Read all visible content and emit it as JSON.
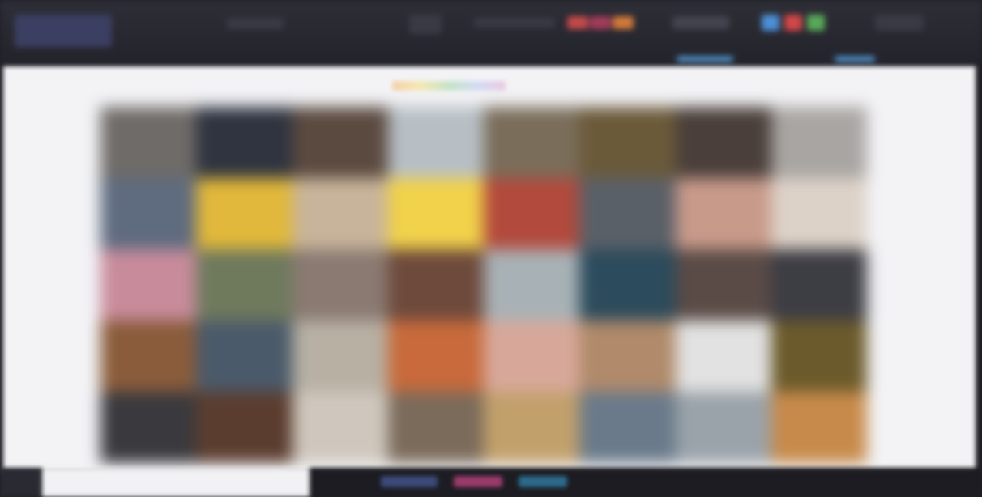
{
  "window": {
    "title": ""
  },
  "topbar": {
    "blocks": [
      {
        "name": "logo",
        "color": "#3b3f62"
      },
      {
        "name": "nav-1",
        "color": "#3a3a44"
      },
      {
        "name": "nav-2",
        "color": "#3a3a44"
      },
      {
        "name": "nav-3",
        "color": "#3a3a44"
      },
      {
        "name": "accent-1",
        "color": "#c54a4a"
      },
      {
        "name": "accent-2",
        "color": "#a43c5a"
      },
      {
        "name": "accent-3",
        "color": "#d27a3a"
      },
      {
        "name": "accent-4",
        "color": "#4d8fd6"
      },
      {
        "name": "accent-5",
        "color": "#d24747"
      },
      {
        "name": "accent-6",
        "color": "#59a85a"
      },
      {
        "name": "highlight-1",
        "color": "#5aa7e8"
      },
      {
        "name": "highlight-2",
        "color": "#5aa7e8"
      }
    ]
  },
  "gallery": {
    "tile_colors": [
      "#6f6b68",
      "#2f3440",
      "#5b4a40",
      "#b7bfc5",
      "#7a6d5a",
      "#6b5a3a",
      "#4a3f3b",
      "#a9a5a2",
      "#5f6b7f",
      "#e1b83b",
      "#c8b49a",
      "#f1d24a",
      "#b24a3d",
      "#5a6068",
      "#c89a8a",
      "#ddd2c8",
      "#c88b9b",
      "#6f7a5d",
      "#8a7a72",
      "#6e4a3c",
      "#a8b2b6",
      "#2c4b5c",
      "#5a4b46",
      "#3d3d44",
      "#8a5c3b",
      "#4b5a6a",
      "#b7b0a3",
      "#c86a3b",
      "#d7a89a",
      "#b08a6a",
      "#e2e2e2",
      "#6b5a2b",
      "#3a3a3e",
      "#5b3d2f",
      "#cfc7bd",
      "#7b6b5b",
      "#c2a06b",
      "#6a7a8a",
      "#9aa3aa",
      "#c78a4a"
    ]
  },
  "bottombar": {
    "tags": [
      {
        "name": "tag-1",
        "color": "#3b4a7a"
      },
      {
        "name": "tag-2",
        "color": "#9a3b6a"
      },
      {
        "name": "tag-3",
        "color": "#2d6a8a"
      }
    ]
  }
}
